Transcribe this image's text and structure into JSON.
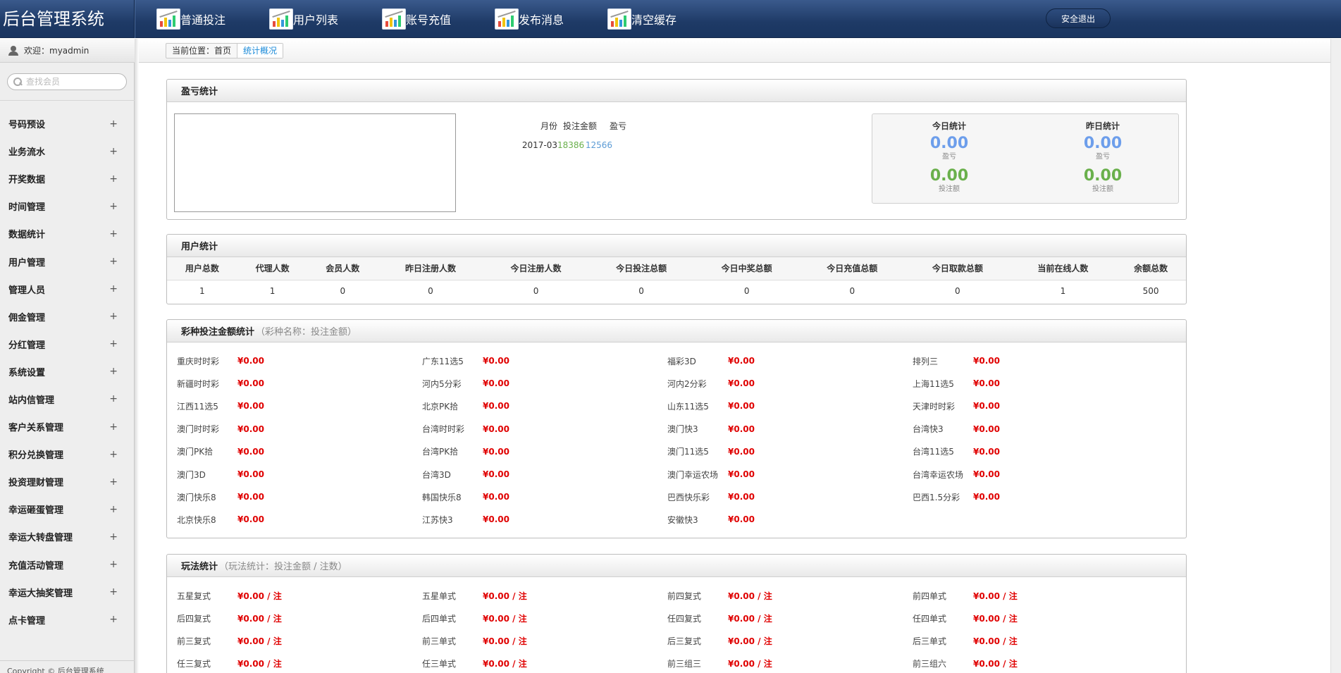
{
  "header": {
    "brand": "后台管理系统",
    "nav": [
      {
        "label": "普通投注"
      },
      {
        "label": "用户列表"
      },
      {
        "label": "账号充值"
      },
      {
        "label": "发布消息"
      },
      {
        "label": "清空缓存"
      }
    ],
    "logout_label": "安全退出"
  },
  "sidebar": {
    "welcome": "欢迎：myadmin",
    "search_placeholder": "查找会员",
    "items": [
      {
        "label": "号码预设"
      },
      {
        "label": "业务流水"
      },
      {
        "label": "开奖数据"
      },
      {
        "label": "时间管理"
      },
      {
        "label": "数据统计"
      },
      {
        "label": "用户管理"
      },
      {
        "label": "管理人员"
      },
      {
        "label": "佣金管理"
      },
      {
        "label": "分红管理"
      },
      {
        "label": "系统设置"
      },
      {
        "label": "站内信管理"
      },
      {
        "label": "客户关系管理"
      },
      {
        "label": "积分兑换管理"
      },
      {
        "label": "投资理财管理"
      },
      {
        "label": "幸运砸蛋管理"
      },
      {
        "label": "幸运大转盘管理"
      },
      {
        "label": "充值活动管理"
      },
      {
        "label": "幸运大抽奖管理"
      },
      {
        "label": "点卡管理"
      }
    ],
    "expand_symbol": "+",
    "copyright": "Copyright © 后台管理系统"
  },
  "breadcrumb": {
    "prefix": "当前位置：首页",
    "current": "统计概况"
  },
  "profit": {
    "title": "盈亏统计",
    "headers": {
      "month": "月份",
      "bet": "投注金额",
      "pl": "盈亏"
    },
    "rows": [
      {
        "month": "2017-03",
        "bet": "18386",
        "pl": "12566"
      }
    ],
    "today": {
      "title": "今日统计",
      "pl_value": "0.00",
      "pl_label": "盈亏",
      "bet_value": "0.00",
      "bet_label": "投注额"
    },
    "yesterday": {
      "title": "昨日统计",
      "pl_value": "0.00",
      "pl_label": "盈亏",
      "bet_value": "0.00",
      "bet_label": "投注额"
    },
    "colors": {
      "bet": "#6ab04c",
      "pl": "#5b9bd5",
      "big_pl": "#6d9eeb",
      "big_bet": "#6ab04c"
    }
  },
  "users": {
    "title": "用户统计",
    "headers": [
      "用户总数",
      "代理人数",
      "会员人数",
      "昨日注册人数",
      "今日注册人数",
      "今日投注总额",
      "今日中奖总额",
      "今日充值总额",
      "今日取款总额",
      "当前在线人数",
      "余额总数"
    ],
    "values": [
      "1",
      "1",
      "0",
      "0",
      "0",
      "0",
      "0",
      "0",
      "0",
      "1",
      "500"
    ]
  },
  "lottery": {
    "title": "彩种投注金额统计",
    "subtitle": "（彩种名称：投注金额）",
    "rows": [
      [
        {
          "name": "重庆时时彩",
          "value": "¥0.00"
        },
        {
          "name": "广东11选5",
          "value": "¥0.00"
        },
        {
          "name": "福彩3D",
          "value": "¥0.00"
        },
        {
          "name": "排列三",
          "value": "¥0.00"
        }
      ],
      [
        {
          "name": "新疆时时彩",
          "value": "¥0.00"
        },
        {
          "name": "河内5分彩",
          "value": "¥0.00"
        },
        {
          "name": "河内2分彩",
          "value": "¥0.00"
        },
        {
          "name": "上海11选5",
          "value": "¥0.00"
        }
      ],
      [
        {
          "name": "江西11选5",
          "value": "¥0.00"
        },
        {
          "name": "北京PK拾",
          "value": "¥0.00"
        },
        {
          "name": "山东11选5",
          "value": "¥0.00"
        },
        {
          "name": "天津时时彩",
          "value": "¥0.00"
        }
      ],
      [
        {
          "name": "澳门时时彩",
          "value": "¥0.00"
        },
        {
          "name": "台湾时时彩",
          "value": "¥0.00"
        },
        {
          "name": "澳门快3",
          "value": "¥0.00"
        },
        {
          "name": "台湾快3",
          "value": "¥0.00"
        }
      ],
      [
        {
          "name": "澳门PK拾",
          "value": "¥0.00"
        },
        {
          "name": "台湾PK拾",
          "value": "¥0.00"
        },
        {
          "name": "澳门11选5",
          "value": "¥0.00"
        },
        {
          "name": "台湾11选5",
          "value": "¥0.00"
        }
      ],
      [
        {
          "name": "澳门3D",
          "value": "¥0.00"
        },
        {
          "name": "台湾3D",
          "value": "¥0.00"
        },
        {
          "name": "澳门幸运农场",
          "value": "¥0.00"
        },
        {
          "name": "台湾幸运农场",
          "value": "¥0.00"
        }
      ],
      [
        {
          "name": "澳门快乐8",
          "value": "¥0.00"
        },
        {
          "name": "韩国快乐8",
          "value": "¥0.00"
        },
        {
          "name": "巴西快乐彩",
          "value": "¥0.00"
        },
        {
          "name": "巴西1.5分彩",
          "value": "¥0.00"
        }
      ],
      [
        {
          "name": "北京快乐8",
          "value": "¥0.00"
        },
        {
          "name": "江苏快3",
          "value": "¥0.00"
        },
        {
          "name": "安徽快3",
          "value": "¥0.00"
        }
      ]
    ]
  },
  "play": {
    "title": "玩法统计",
    "subtitle": "（玩法统计：投注金额 / 注数）",
    "rows": [
      [
        {
          "name": "五星复式",
          "value": "¥0.00 / 注"
        },
        {
          "name": "五星单式",
          "value": "¥0.00 / 注"
        },
        {
          "name": "前四复式",
          "value": "¥0.00 / 注"
        },
        {
          "name": "前四单式",
          "value": "¥0.00 / 注"
        }
      ],
      [
        {
          "name": "后四复式",
          "value": "¥0.00 / 注"
        },
        {
          "name": "后四单式",
          "value": "¥0.00 / 注"
        },
        {
          "name": "任四复式",
          "value": "¥0.00 / 注"
        },
        {
          "name": "任四单式",
          "value": "¥0.00 / 注"
        }
      ],
      [
        {
          "name": "前三复式",
          "value": "¥0.00 / 注"
        },
        {
          "name": "前三单式",
          "value": "¥0.00 / 注"
        },
        {
          "name": "后三复式",
          "value": "¥0.00 / 注"
        },
        {
          "name": "后三单式",
          "value": "¥0.00 / 注"
        }
      ],
      [
        {
          "name": "任三复式",
          "value": "¥0.00 / 注"
        },
        {
          "name": "任三单式",
          "value": "¥0.00 / 注"
        },
        {
          "name": "前三组三",
          "value": "¥0.00 / 注"
        },
        {
          "name": "前三组六",
          "value": "¥0.00 / 注"
        }
      ]
    ]
  }
}
